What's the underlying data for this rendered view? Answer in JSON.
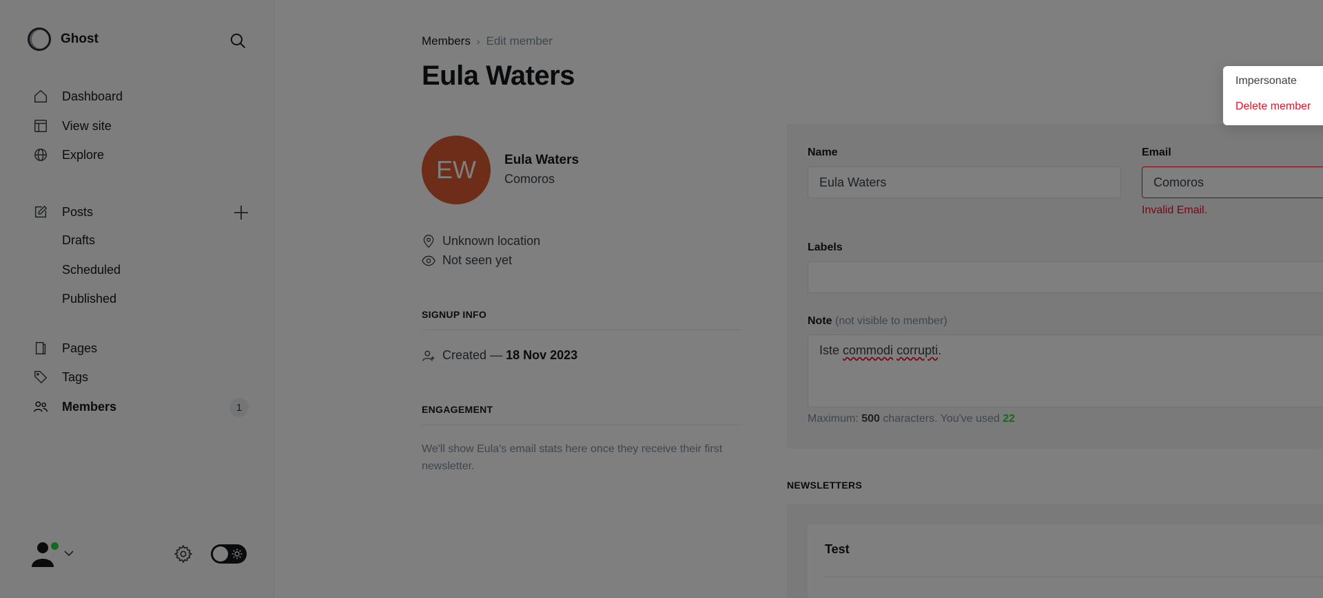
{
  "brand": {
    "name": "Ghost"
  },
  "nav": {
    "dashboard": "Dashboard",
    "view_site": "View site",
    "explore": "Explore",
    "posts": "Posts",
    "drafts": "Drafts",
    "scheduled": "Scheduled",
    "published": "Published",
    "pages": "Pages",
    "tags": "Tags",
    "members": "Members",
    "members_count": "1"
  },
  "breadcrumb": {
    "parent": "Members",
    "separator": "›",
    "current": "Edit member"
  },
  "page": {
    "title": "Eula Waters"
  },
  "member": {
    "initials": "EW",
    "name": "Eula Waters",
    "subtitle": "Comoros",
    "location": "Unknown location",
    "seen": "Not seen yet",
    "signup_heading": "SIGNUP INFO",
    "created_prefix": "Created — ",
    "created_date": "18 Nov 2023",
    "engagement_heading": "ENGAGEMENT",
    "engagement_text": "We'll show Eula's email stats here once they receive their first newsletter."
  },
  "form": {
    "name_label": "Name",
    "name_value": "Eula Waters",
    "email_label": "Email",
    "email_value": "Comoros",
    "email_error": "Invalid Email.",
    "labels_label": "Labels",
    "labels_value": "",
    "note_label": "Note",
    "note_muted": "(not visible to member)",
    "note_word1": "Iste",
    "note_word2": "commodi",
    "note_word3": "corrupti",
    "note_end": ".",
    "hint_prefix": "Maximum: ",
    "hint_max": "500",
    "hint_mid": " characters. You've used ",
    "hint_used": "22"
  },
  "newsletters": {
    "heading": "NEWSLETTERS",
    "items": [
      {
        "name": "Test"
      }
    ]
  },
  "dropdown": {
    "impersonate": "Impersonate",
    "delete": "Delete member"
  },
  "colors": {
    "accent_green": "#30cf43",
    "error_red": "#f50b23",
    "avatar_orange": "#dc5a33",
    "overlay": "rgba(0,0,0,0.5)"
  }
}
